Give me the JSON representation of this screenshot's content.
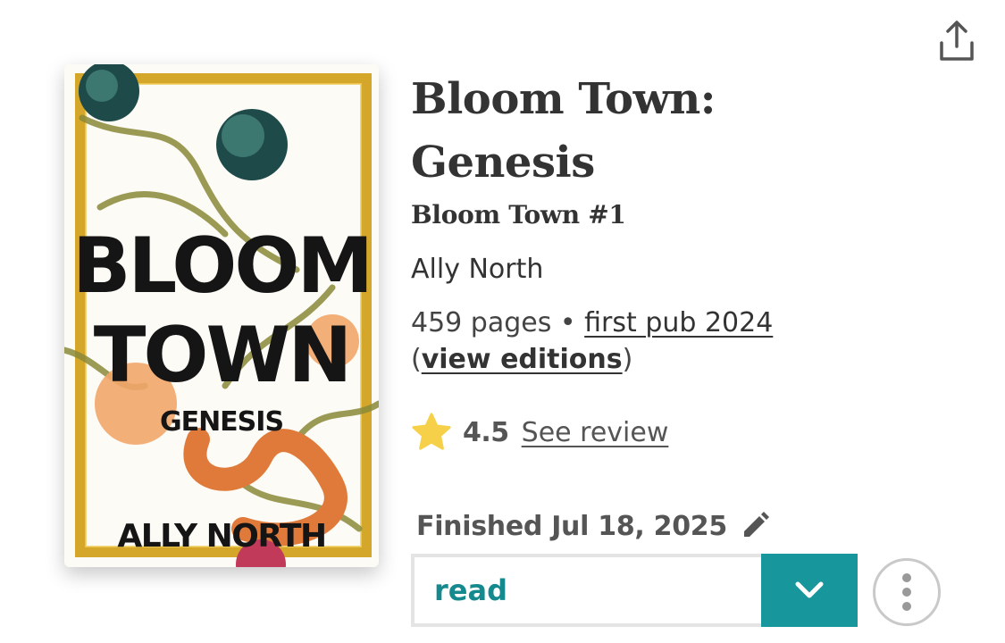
{
  "book": {
    "title_line1": "Bloom Town:",
    "title_line2": "Genesis",
    "series": "Bloom Town #1",
    "author": "Ally North",
    "pages": "459 pages",
    "separator": "•",
    "first_pub": "first pub 2024",
    "view_editions": "view editions",
    "cover": {
      "title_line1": "BLOOM",
      "title_line2": "TOWN",
      "subtitle": "GENESIS",
      "author": "ALLY NORTH"
    }
  },
  "rating": {
    "value": "4.5",
    "see_review": "See review",
    "icon": "star-icon"
  },
  "reading": {
    "finished": "Finished Jul 18, 2025",
    "status": "read"
  },
  "icons": {
    "share": "share-icon",
    "edit": "pencil-icon",
    "dropdown": "chevron-down-icon",
    "more": "more-vertical-icon"
  },
  "colors": {
    "accent": "#17979c",
    "status_text": "#158a8e",
    "star": "#f7d04a",
    "cover_frame": "#d4a62a"
  }
}
